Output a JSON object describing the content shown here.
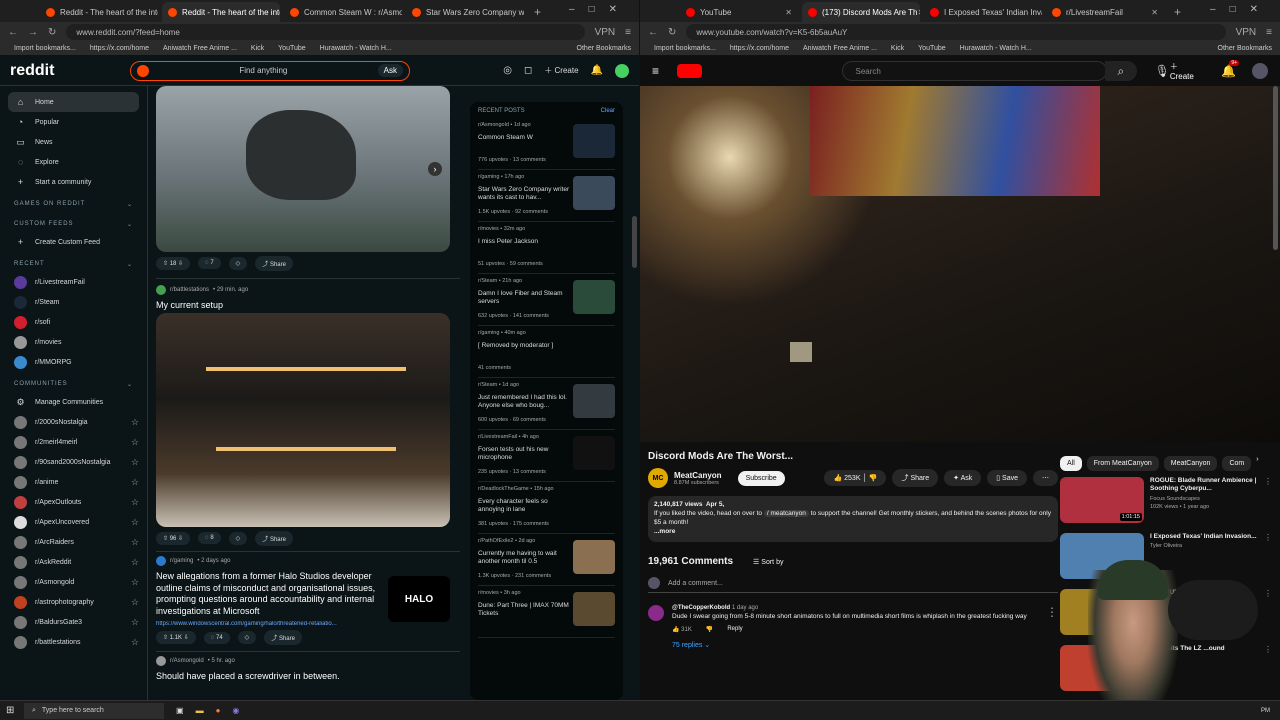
{
  "left_browser": {
    "tabs": [
      {
        "title": "Reddit - The heart of the interne",
        "color": "#ff4500"
      },
      {
        "title": "Reddit - The heart of the interne",
        "color": "#ff4500"
      },
      {
        "title": "Common Steam W : r/Asmongo",
        "color": "#ff4500"
      },
      {
        "title": "Star Wars Zero Company write",
        "color": "#ff4500"
      }
    ],
    "url": "www.reddit.com/?feed=home",
    "vpn": "VPN",
    "bookmarks": [
      "Import bookmarks...",
      "https://x.com/home",
      "Aniwatch Free Anime ...",
      "Kick",
      "YouTube",
      "Hurawatch - Watch H...",
      "Other Bookmarks"
    ]
  },
  "reddit": {
    "logo": "reddit",
    "search_placeholder": "Find anything",
    "ask": "Ask",
    "create": "Create",
    "nav": [
      "Home",
      "Popular",
      "News",
      "Explore",
      "Start a community"
    ],
    "games_header": "GAMES ON REDDIT",
    "custom_feeds_header": "CUSTOM FEEDS",
    "create_custom_feed": "Create Custom Feed",
    "recent_header": "RECENT",
    "recent": [
      "r/LivestreamFail",
      "r/Steam",
      "r/sofi",
      "r/movies",
      "r/MMORPG"
    ],
    "communities_header": "COMMUNITIES",
    "manage_communities": "Manage Communities",
    "communities": [
      "r/2000sNostalgia",
      "r/2meirl4meirl",
      "r/90sand2000sNostalgia",
      "r/anime",
      "r/ApexOutlouts",
      "r/ApexUncovered",
      "r/ArcRaiders",
      "r/AskReddit",
      "r/Asmongold",
      "r/astrophotography",
      "r/BaldursGate3",
      "r/battlestations"
    ],
    "post1": {
      "votes": "18",
      "comments": "7",
      "share": "Share"
    },
    "post2": {
      "sub": "r/battlestations",
      "time": "• 29 min. ago",
      "title": "My current setup",
      "votes": "96",
      "comments": "8",
      "share": "Share"
    },
    "post3": {
      "sub": "r/gaming",
      "time": "• 2 days ago",
      "title": "New allegations from a former Halo Studios developer outline claims of misconduct and organisational issues, prompting questions around accountability and internal investigations at Microsoft",
      "link": "https://www.windowscentral.com/gaming/halo/threatened-retaliatio...",
      "votes": "1.1K",
      "comments": "74",
      "share": "Share",
      "thumb": "HALO"
    },
    "post4": {
      "sub": "r/Asmongold",
      "time": "• 5 hr. ago",
      "title": "Should have placed a screwdriver in between."
    },
    "recent_posts_header": "RECENT POSTS",
    "clear": "Clear",
    "recent_posts": [
      {
        "sub": "r/Asmongold • 1d ago",
        "title": "Common Steam W",
        "stats": "776 upvotes · 13 comments",
        "color": "#1b2838"
      },
      {
        "sub": "r/gaming • 17h ago",
        "title": "Star Wars Zero Company writer wants its cast to hav...",
        "stats": "1.5K upvotes · 92 comments",
        "color": "#3a4a5a"
      },
      {
        "sub": "r/movies • 32m ago",
        "title": "I miss Peter Jackson",
        "stats": "51 upvotes · 59 comments",
        "color": ""
      },
      {
        "sub": "r/Steam • 21h ago",
        "title": "Damn I love Fiber and Steam servers",
        "stats": "632 upvotes · 141 comments",
        "color": "#2a4a3a"
      },
      {
        "sub": "r/gaming • 40m ago",
        "title": "[ Removed by moderator ]",
        "stats": "41 comments",
        "color": ""
      },
      {
        "sub": "r/Steam • 1d ago",
        "title": "Just remembered I had this lol. Anyone else who boug...",
        "stats": "600 upvotes · 69 comments",
        "color": "#333b40"
      },
      {
        "sub": "r/LivestreamFail • 4h ago",
        "title": "Forsen tests out his new microphone",
        "stats": "235 upvotes · 13 comments",
        "color": "#111"
      },
      {
        "sub": "r/DeadlockTheGame • 15h ago",
        "title": "Every character feels so annoying in lane",
        "stats": "381 upvotes · 175 comments",
        "color": ""
      },
      {
        "sub": "r/PathOfExile2 • 2d ago",
        "title": "Currently me having to wait another month til 0.5",
        "stats": "1.3K upvotes · 231 comments",
        "color": "#8a7050"
      },
      {
        "sub": "r/movies • 3h ago",
        "title": "Dune: Part Three | IMAX 70MM Tickets",
        "stats": "",
        "color": "#5a4a30"
      }
    ]
  },
  "right_browser": {
    "tabs": [
      {
        "title": "YouTube",
        "color": "#ff0000"
      },
      {
        "title": "(173) Discord Mods Are Th",
        "color": "#ff0000"
      },
      {
        "title": "I Exposed Texas' Indian Invasio",
        "color": "#ff0000"
      },
      {
        "title": "r/LivestreamFail",
        "color": "#ff4500"
      }
    ],
    "url": "www.youtube.com/watch?v=K5-6b5auAuY",
    "vpn": "VPN"
  },
  "youtube": {
    "search_placeholder": "Search",
    "create": "Create",
    "notif_count": "9+",
    "video_title": "Discord Mods Are The Worst...",
    "channel": "MeatCanyon",
    "subscribers": "8.87M subscribers",
    "subscribe": "Subscribe",
    "likes": "253K",
    "share": "Share",
    "ask": "Ask",
    "save": "Save",
    "views": "2,140,817 views",
    "date": "Apr 5,",
    "description": "If you liked the video, head on over to",
    "desc_link": "/ meatcanyon",
    "description2": "to support the channel! Get monthly stickers, and behind the scenes photos for only $5 a month!",
    "more": "...more",
    "comment_count": "19,961 Comments",
    "sort": "Sort by",
    "add_comment": "Add a comment...",
    "comment": {
      "user": "@TheCopperKobold",
      "time": "1 day ago",
      "text": "Dude I swear going from 5-8 minute short animatons to full on multimedia short films is whiplash in the greatest fucking way",
      "likes": "31K",
      "reply": "Reply",
      "replies": "75 replies"
    },
    "chips": [
      "All",
      "From MeatCanyon",
      "MeatCanyon",
      "Com"
    ],
    "recs": [
      {
        "title": "ROGUE: Blade Runner Ambience | Soothing Cyberpu...",
        "channel": "Focus Soundscapes",
        "meta": "102K views • 1 year ago",
        "duration": "1:01:15",
        "color": "#b03040"
      },
      {
        "title": "I Exposed Texas' Indian Invasion...",
        "channel": "Tyler Oliveira",
        "meta": "",
        "duration": "",
        "color": "#5080b0"
      },
      {
        "title": "MANHUNT proves rockstar ... | Manhunt review",
        "channel": "",
        "meta": "",
        "duration": "",
        "color": "#a08020"
      },
      {
        "title": "...g Visits The LZ ...ound",
        "channel": "",
        "meta": "",
        "duration": "",
        "color": "#c04030"
      }
    ]
  },
  "taskbar": {
    "search": "Type here to search",
    "time": "PM"
  }
}
